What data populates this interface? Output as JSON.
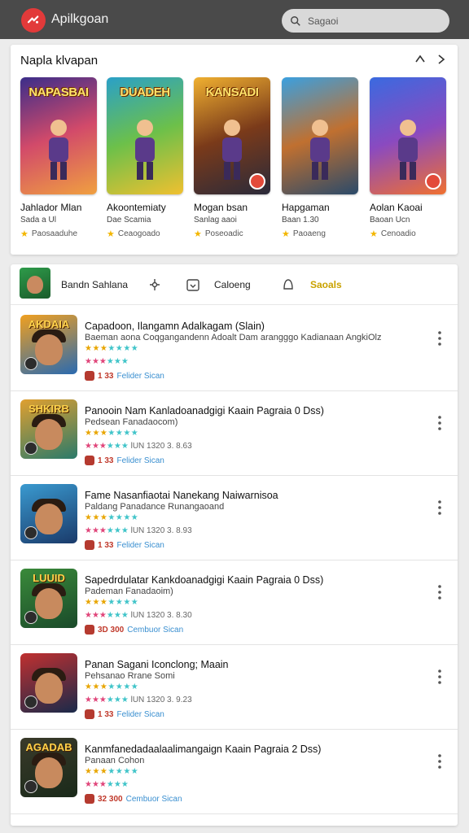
{
  "header": {
    "app_title": "Apilkgoan",
    "search_placeholder": "Sagaoi",
    "logo_icon": "gamepad-icon",
    "brand_color": "#e23a3a"
  },
  "featured": {
    "title": "Napla klvapan",
    "games": [
      {
        "cover": "NAPASBAI",
        "name": "Jahlador Mlan",
        "sub": "Sada a Ul",
        "rating": "Paosaaduhe",
        "bg": "linear-gradient(160deg,#3b2d8a,#d24a6a,#f0a040)"
      },
      {
        "cover": "DUADEH",
        "name": "Akoontemiaty",
        "sub": "Dae Scamia",
        "rating": "Ceaogoado",
        "bg": "linear-gradient(160deg,#2aa0c8,#6cc04a,#f0c030)"
      },
      {
        "cover": "KANSADI",
        "name": "Mogan bsan",
        "sub": "Sanlag aaoi",
        "rating": "Poseoadic",
        "bg": "linear-gradient(160deg,#f0b030,#7a3a1a,#2a2a3a)"
      },
      {
        "cover": "",
        "name": "Hapgaman",
        "sub": "Baan 1.30",
        "rating": "Paoaeng",
        "bg": "linear-gradient(160deg,#3aa0e0,#c07030,#2a4a6a)"
      },
      {
        "cover": "",
        "name": "Aolan Kaoai",
        "sub": "Baoan Ucn",
        "rating": "Cenoadio",
        "bg": "linear-gradient(160deg,#3a6ae0,#8a4ac0,#f07030)"
      }
    ]
  },
  "tabs": {
    "items": [
      "Bandn Sahlana",
      "Caloeng",
      "Saoals"
    ]
  },
  "list": [
    {
      "thumb_title": "AKDAIA",
      "title": "Capadoon, Ilangamn Adalkagam (Slain)",
      "sub": "Baeman aona Coqgangandenn Adoalt Dam arangggo Kadianaan AngkiOlz",
      "stars2": "",
      "meta_count": "1 33",
      "meta_tag": "Felider Sican",
      "thumb_bg": "linear-gradient(160deg,#f0a020,#2a6ab0)"
    },
    {
      "thumb_title": "SHKIRB",
      "title": "Panooin Nam Kanladoanadgigi Kaain Pagraia 0 Dss)",
      "sub": "Pedsean Fanadaocom)",
      "stars2": "lUN 1320 3. 8.63",
      "meta_count": "1 33",
      "meta_tag": "Felider Sican",
      "thumb_bg": "linear-gradient(160deg,#e0a030,#2a7a6a)"
    },
    {
      "thumb_title": "",
      "title": "Fame Nasanfiaotai Nanekang Naiwarnisoa",
      "sub": "Paldang Panadance Runangaoand",
      "stars2": "lUN 1320 3. 8.93",
      "meta_count": "1 33",
      "meta_tag": "Felider Sican",
      "thumb_bg": "linear-gradient(160deg,#3a9ad0,#1a3a6a)"
    },
    {
      "thumb_title": "LUUID",
      "title": "Sapedrdulatar Kankdoanadgigi Kaain Pagraia 0 Dss)",
      "sub": "Pademan Fanadaoim)",
      "stars2": "lUN 1320 3. 8.30",
      "meta_count": "3D 300",
      "meta_tag": "Cembuor Sican",
      "thumb_bg": "linear-gradient(160deg,#3a8a3a,#1a4a2a)"
    },
    {
      "thumb_title": "",
      "title": "Panan Sagani Iconclong; Maain",
      "sub": "Pehsanao Rrane Somi",
      "stars2": "lUN 1320 3. 9.23",
      "meta_count": "1 33",
      "meta_tag": "Felider Sican",
      "thumb_bg": "linear-gradient(160deg,#c03030,#1a2a4a)"
    },
    {
      "thumb_title": "AGADAB",
      "title": "Kanmfanedadaalaalimangaign Kaain Pagraia 2 Dss)",
      "sub": "Panaan Cohon",
      "stars2": "",
      "meta_count": "32 300",
      "meta_tag": "Cembuor Sican",
      "thumb_bg": "linear-gradient(160deg,#3a3a2a,#1a2a1a)"
    }
  ]
}
